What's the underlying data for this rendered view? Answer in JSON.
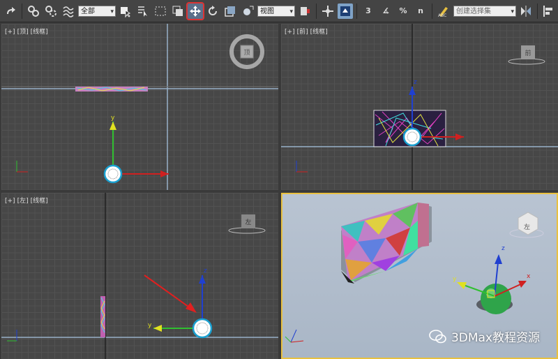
{
  "toolbar": {
    "selection_filter": "全部",
    "ref_coord": "视图",
    "named_selection_placeholder": "创建选择集",
    "snap_labels": [
      "3",
      "∡",
      "%",
      "n"
    ]
  },
  "viewports": {
    "top": {
      "plus": "[+]",
      "view": "[顶]",
      "shading": "[线框]"
    },
    "front": {
      "plus": "[+]",
      "view": "[前]",
      "shading": "[线框]"
    },
    "left": {
      "plus": "[+]",
      "view": "[左]",
      "shading": "[线框]"
    },
    "persp": {
      "plus": "",
      "view": "",
      "shading": ""
    }
  },
  "viewcube": {
    "top_face": "顶",
    "front_face": "前",
    "left_face": "左",
    "persp_face": "左"
  },
  "axes": {
    "x": "x",
    "y": "y",
    "z": "z"
  },
  "watermark": "3DMax教程资源",
  "colors": {
    "active_outline": "#dd3333",
    "axis_x": "#d02020",
    "axis_y": "#30c030",
    "axis_z": "#2040d0"
  }
}
